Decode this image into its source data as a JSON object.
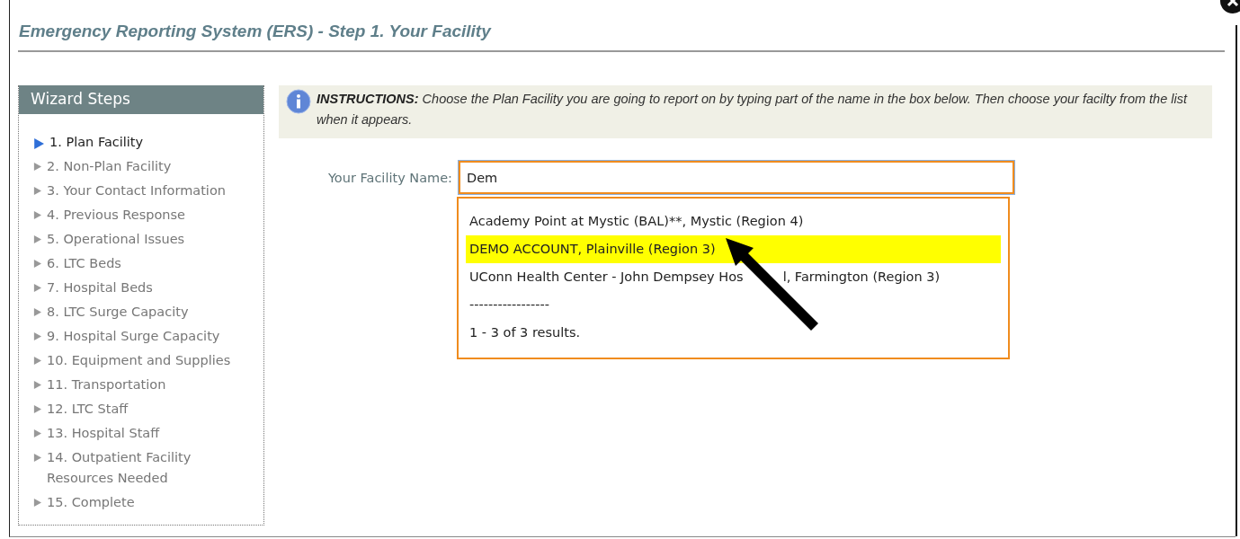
{
  "page_title": "Emergency Reporting System (ERS) - Step 1. Your Facility",
  "sidebar": {
    "title": "Wizard Steps",
    "items": [
      {
        "label": "1. Plan Facility",
        "selected": true
      },
      {
        "label": "2. Non-Plan Facility",
        "selected": false
      },
      {
        "label": "3. Your Contact Information",
        "selected": false
      },
      {
        "label": "4. Previous Response",
        "selected": false
      },
      {
        "label": "5. Operational Issues",
        "selected": false
      },
      {
        "label": "6. LTC Beds",
        "selected": false
      },
      {
        "label": "7. Hospital Beds",
        "selected": false
      },
      {
        "label": "8. LTC Surge Capacity",
        "selected": false
      },
      {
        "label": "9. Hospital Surge Capacity",
        "selected": false
      },
      {
        "label": "10. Equipment and Supplies",
        "selected": false
      },
      {
        "label": "11. Transportation",
        "selected": false
      },
      {
        "label": "12. LTC Staff",
        "selected": false
      },
      {
        "label": "13. Hospital Staff",
        "selected": false
      },
      {
        "label": "14. Outpatient Facility Resources Needed",
        "selected": false
      },
      {
        "label": "15. Complete",
        "selected": false
      }
    ]
  },
  "instructions": "**INSTRUCTIONS:** Choose the Plan Facility you are going to report on by typing part of the name in the box below. Then choose your facilty from the list when it appears.",
  "facility_field": {
    "label": "Your Facility Name:",
    "value": "Dem"
  },
  "suggestions": {
    "items": [
      {
        "label": "Academy Point at Mystic (BAL)**, Mystic (Region 4)",
        "selected": false
      },
      {
        "label": "DEMO ACCOUNT, Plainville (Region 3)",
        "selected": true
      },
      {
        "label_parts": [
          "UConn Health Center - John Dempsey Hos",
          "l, Farmington (Region 3)"
        ],
        "selected": false
      }
    ],
    "separator": "-----------------",
    "summary": "1 - 3 of 3 results."
  }
}
